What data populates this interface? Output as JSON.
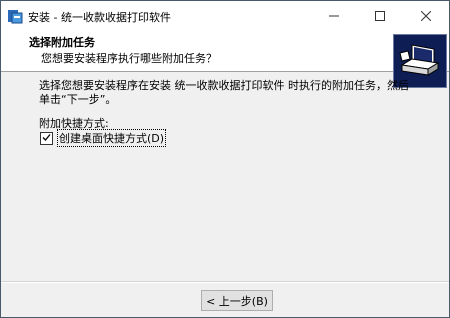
{
  "window": {
    "title": "安装 - 统一收款收据打印软件"
  },
  "header": {
    "title": "选择附加任务",
    "subtitle": "您想要安装程序执行哪些附加任务？"
  },
  "content": {
    "description": "选择您想要安装程序在安装 统一收款收据打印软件 时执行的附加任务，然后单击“下一步”。",
    "group_label": "附加快捷方式:",
    "checkbox_label": "创建桌面快捷方式(D)",
    "checkbox_checked": true
  },
  "buttons": {
    "back": "< 上一步(B)"
  },
  "colors": {
    "wizard_image_bg": "#0e1e55",
    "header_bg": "#ffffff",
    "dialog_bg": "#f0f0f0"
  },
  "icons": {
    "app": "installer-icon",
    "minimize": "minimize-icon",
    "maximize": "maximize-icon",
    "close": "close-icon",
    "wizard": "computer-install-icon",
    "checkmark": "checkmark-icon"
  }
}
